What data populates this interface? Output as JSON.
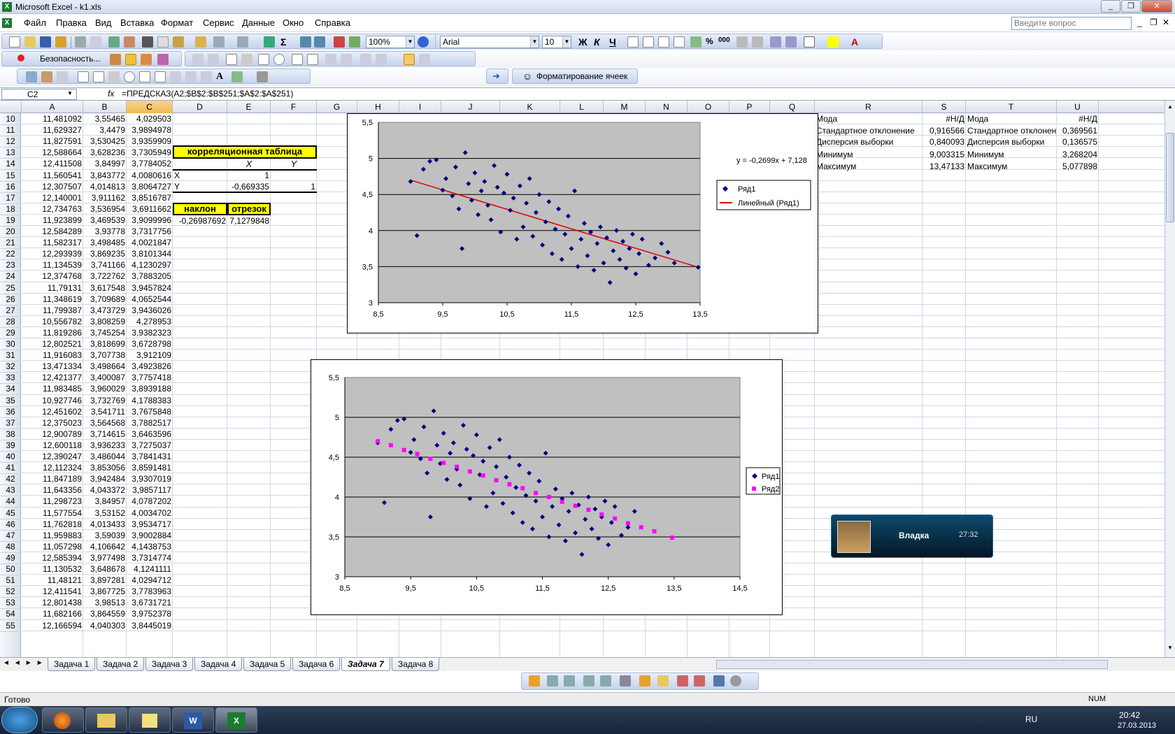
{
  "window": {
    "title": "Microsoft Excel - k1.xls"
  },
  "menu": [
    "Файл",
    "Правка",
    "Вид",
    "Вставка",
    "Формат",
    "Сервис",
    "Данные",
    "Окно",
    "Справка"
  ],
  "help_search": {
    "placeholder": "Введите вопрос"
  },
  "toolbar": {
    "zoom": "100%",
    "font": "Arial",
    "font_size": "10",
    "security_label": "Безопасность...",
    "format_cells_label": "Форматирование ячеек"
  },
  "formula_bar": {
    "name_box": "C2",
    "fx": "fx",
    "formula": "=ПРЕДСКАЗ(A2;$B$2:$B$251;$A$2:$A$251)"
  },
  "columns": [
    "A",
    "B",
    "C",
    "D",
    "E",
    "F",
    "G",
    "H",
    "I",
    "J",
    "K",
    "L",
    "M",
    "N",
    "O",
    "P",
    "Q",
    "R",
    "S",
    "T",
    "U"
  ],
  "rows": [
    {
      "n": "10",
      "a": "11,481092",
      "b": "3,55465",
      "c": "4,029503"
    },
    {
      "n": "11",
      "a": "11,629327",
      "b": "3,4479",
      "c": "3,9894978"
    },
    {
      "n": "12",
      "a": "11,827591",
      "b": "3,530425",
      "c": "3,9359909"
    },
    {
      "n": "13",
      "a": "12,588664",
      "b": "3,628236",
      "c": "3,7305949"
    },
    {
      "n": "14",
      "a": "12,411508",
      "b": "3,84997",
      "c": "3,7784052"
    },
    {
      "n": "15",
      "a": "11,560541",
      "b": "3,843772",
      "c": "4,0080616"
    },
    {
      "n": "16",
      "a": "12,307507",
      "b": "4,014813",
      "c": "3,8064727"
    },
    {
      "n": "17",
      "a": "12,140001",
      "b": "3,911162",
      "c": "3,8516787"
    },
    {
      "n": "18",
      "a": "12,734763",
      "b": "3,536954",
      "c": "3,6911662"
    },
    {
      "n": "19",
      "a": "11,923899",
      "b": "3,469539",
      "c": "3,9099996"
    },
    {
      "n": "20",
      "a": "12,584289",
      "b": "3,93778",
      "c": "3,7317756"
    },
    {
      "n": "21",
      "a": "11,582317",
      "b": "3,498485",
      "c": "4,0021847"
    },
    {
      "n": "22",
      "a": "12,293939",
      "b": "3,869235",
      "c": "3,8101344"
    },
    {
      "n": "23",
      "a": "11,134539",
      "b": "3,741166",
      "c": "4,1230297"
    },
    {
      "n": "24",
      "a": "12,374768",
      "b": "3,722762",
      "c": "3,7883205"
    },
    {
      "n": "25",
      "a": "11,79131",
      "b": "3,617548",
      "c": "3,9457824"
    },
    {
      "n": "26",
      "a": "11,348619",
      "b": "3,709689",
      "c": "4,0652544"
    },
    {
      "n": "27",
      "a": "11,799387",
      "b": "3,473729",
      "c": "3,9436026"
    },
    {
      "n": "28",
      "a": "10,556782",
      "b": "3,808259",
      "c": "4,278953"
    },
    {
      "n": "29",
      "a": "11,819286",
      "b": "3,745254",
      "c": "3,9382323"
    },
    {
      "n": "30",
      "a": "12,802521",
      "b": "3,818699",
      "c": "3,6728798"
    },
    {
      "n": "31",
      "a": "11,916083",
      "b": "3,707738",
      "c": "3,912109"
    },
    {
      "n": "32",
      "a": "13,471334",
      "b": "3,498664",
      "c": "3,4923826"
    },
    {
      "n": "33",
      "a": "12,421377",
      "b": "3,400087",
      "c": "3,7757418"
    },
    {
      "n": "34",
      "a": "11,983485",
      "b": "3,960029",
      "c": "3,8939188"
    },
    {
      "n": "35",
      "a": "10,927746",
      "b": "3,732769",
      "c": "4,1788383"
    },
    {
      "n": "36",
      "a": "12,451602",
      "b": "3,541711",
      "c": "3,7675848"
    },
    {
      "n": "37",
      "a": "12,375023",
      "b": "3,564568",
      "c": "3,7882517"
    },
    {
      "n": "38",
      "a": "12,900789",
      "b": "3,714615",
      "c": "3,6463596"
    },
    {
      "n": "39",
      "a": "12,600118",
      "b": "3,936233",
      "c": "3,7275037"
    },
    {
      "n": "40",
      "a": "12,390247",
      "b": "3,486044",
      "c": "3,7841431"
    },
    {
      "n": "41",
      "a": "12,112324",
      "b": "3,853056",
      "c": "3,8591481"
    },
    {
      "n": "42",
      "a": "11,847189",
      "b": "3,942484",
      "c": "3,9307019"
    },
    {
      "n": "43",
      "a": "11,643356",
      "b": "4,043372",
      "c": "3,9857117"
    },
    {
      "n": "44",
      "a": "11,298723",
      "b": "3,84957",
      "c": "4,0787202"
    },
    {
      "n": "45",
      "a": "11,577554",
      "b": "3,53152",
      "c": "4,0034702"
    },
    {
      "n": "46",
      "a": "11,762818",
      "b": "4,013433",
      "c": "3,9534717"
    },
    {
      "n": "47",
      "a": "11,959883",
      "b": "3,59039",
      "c": "3,9002884"
    },
    {
      "n": "48",
      "a": "11,057298",
      "b": "4,106642",
      "c": "4,1438753"
    },
    {
      "n": "49",
      "a": "12,585394",
      "b": "3,977498",
      "c": "3,7314774"
    },
    {
      "n": "50",
      "a": "11,130532",
      "b": "3,648678",
      "c": "4,1241111"
    },
    {
      "n": "51",
      "a": "11,48121",
      "b": "3,897281",
      "c": "4,0294712"
    },
    {
      "n": "52",
      "a": "12,411541",
      "b": "3,867725",
      "c": "3,7783963"
    },
    {
      "n": "53",
      "a": "12,801438",
      "b": "3,98513",
      "c": "3,6731721"
    },
    {
      "n": "54",
      "a": "11,682166",
      "b": "3,864559",
      "c": "3,9752378"
    },
    {
      "n": "55",
      "a": "12,166594",
      "b": "4,040303",
      "c": "3,8445019"
    }
  ],
  "corr": {
    "title": "корреляционная таблица",
    "col_x": "X",
    "col_y": "Y",
    "row_x": "X",
    "row_y": "Y",
    "xx": "1",
    "yx": "-0,669335",
    "yy": "1"
  },
  "regression": {
    "slope_label": "наклон",
    "intercept_label": "отрезок",
    "slope": "-0,26987692",
    "intercept": "7,1279848"
  },
  "stats": [
    {
      "label": "Мода",
      "s": "#Н/Д",
      "label2": "Мода",
      "u": "#Н/Д"
    },
    {
      "label": "Стандартное отклонение",
      "s": "0,916566",
      "label2": "Стандартное отклонен",
      "u": "0,369561"
    },
    {
      "label": "Дисперсия выборки",
      "s": "0,840093",
      "label2": "Дисперсия выборки",
      "u": "0,136575"
    },
    {
      "label": "Минимум",
      "s": "9,003315",
      "label2": "Минимум",
      "u": "3,268204"
    },
    {
      "label": "Максимум",
      "s": "13,47133",
      "label2": "Максимум",
      "u": "5,077898"
    }
  ],
  "chart_data": [
    {
      "type": "scatter",
      "x_ticks": [
        "8,5",
        "9,5",
        "10,5",
        "11,5",
        "12,5",
        "13,5"
      ],
      "y_ticks": [
        "3",
        "3,5",
        "4",
        "4,5",
        "5",
        "5,5"
      ],
      "xlim": [
        8.5,
        13.5
      ],
      "ylim": [
        3,
        5.5
      ],
      "grid": "horizontal",
      "trendline_equation": "y = -0,2699x + 7,128",
      "legend": [
        "Ряд1",
        "Линейный (Ряд1)"
      ],
      "legend_position": "right",
      "trendline": {
        "slope": -0.2699,
        "intercept": 7.128,
        "x_from": 9.0,
        "x_to": 13.47
      },
      "series": [
        {
          "name": "Ряд1",
          "color": "#000080",
          "points": [
            [
              9.0,
              4.68
            ],
            [
              9.1,
              3.93
            ],
            [
              9.2,
              4.85
            ],
            [
              9.3,
              4.96
            ],
            [
              9.4,
              4.98
            ],
            [
              9.5,
              4.56
            ],
            [
              9.55,
              4.72
            ],
            [
              9.65,
              4.48
            ],
            [
              9.7,
              4.88
            ],
            [
              9.75,
              4.3
            ],
            [
              9.8,
              3.75
            ],
            [
              9.85,
              5.08
            ],
            [
              9.9,
              4.65
            ],
            [
              9.95,
              4.42
            ],
            [
              10.0,
              4.8
            ],
            [
              10.05,
              4.22
            ],
            [
              10.1,
              4.55
            ],
            [
              10.15,
              4.68
            ],
            [
              10.2,
              4.35
            ],
            [
              10.25,
              4.15
            ],
            [
              10.3,
              4.9
            ],
            [
              10.35,
              4.6
            ],
            [
              10.4,
              3.98
            ],
            [
              10.45,
              4.52
            ],
            [
              10.5,
              4.78
            ],
            [
              10.55,
              4.28
            ],
            [
              10.6,
              4.45
            ],
            [
              10.65,
              3.88
            ],
            [
              10.7,
              4.62
            ],
            [
              10.75,
              4.05
            ],
            [
              10.8,
              4.38
            ],
            [
              10.85,
              4.72
            ],
            [
              10.9,
              3.92
            ],
            [
              10.95,
              4.25
            ],
            [
              11.0,
              4.5
            ],
            [
              11.05,
              3.8
            ],
            [
              11.1,
              4.12
            ],
            [
              11.15,
              4.4
            ],
            [
              11.2,
              3.68
            ],
            [
              11.25,
              4.02
            ],
            [
              11.3,
              4.3
            ],
            [
              11.35,
              3.6
            ],
            [
              11.4,
              3.95
            ],
            [
              11.45,
              4.2
            ],
            [
              11.5,
              3.75
            ],
            [
              11.55,
              4.55
            ],
            [
              11.6,
              3.5
            ],
            [
              11.65,
              3.88
            ],
            [
              11.7,
              4.1
            ],
            [
              11.75,
              3.65
            ],
            [
              11.8,
              3.98
            ],
            [
              11.85,
              3.45
            ],
            [
              11.9,
              3.82
            ],
            [
              11.95,
              4.05
            ],
            [
              12.0,
              3.55
            ],
            [
              12.05,
              3.9
            ],
            [
              12.1,
              3.28
            ],
            [
              12.15,
              3.72
            ],
            [
              12.2,
              4.0
            ],
            [
              12.25,
              3.6
            ],
            [
              12.3,
              3.85
            ],
            [
              12.35,
              3.48
            ],
            [
              12.4,
              3.75
            ],
            [
              12.45,
              3.95
            ],
            [
              12.5,
              3.4
            ],
            [
              12.55,
              3.68
            ],
            [
              12.6,
              3.88
            ],
            [
              12.7,
              3.52
            ],
            [
              12.8,
              3.62
            ],
            [
              12.9,
              3.82
            ],
            [
              13.0,
              3.7
            ],
            [
              13.1,
              3.55
            ],
            [
              13.47,
              3.49
            ]
          ]
        }
      ]
    },
    {
      "type": "scatter",
      "x_ticks": [
        "8,5",
        "9,5",
        "10,5",
        "11,5",
        "12,5",
        "13,5",
        "14,5"
      ],
      "y_ticks": [
        "3",
        "3,5",
        "4",
        "4,5",
        "5",
        "5,5"
      ],
      "xlim": [
        8.5,
        14.5
      ],
      "ylim": [
        3,
        5.5
      ],
      "grid": "horizontal",
      "legend": [
        "Ряд1",
        "Ряд2"
      ],
      "legend_position": "right",
      "series": [
        {
          "name": "Ряд1",
          "color": "#000080",
          "points": [
            [
              9.0,
              4.68
            ],
            [
              9.1,
              3.93
            ],
            [
              9.2,
              4.85
            ],
            [
              9.3,
              4.96
            ],
            [
              9.4,
              4.98
            ],
            [
              9.5,
              4.56
            ],
            [
              9.55,
              4.72
            ],
            [
              9.65,
              4.48
            ],
            [
              9.7,
              4.88
            ],
            [
              9.75,
              4.3
            ],
            [
              9.8,
              3.75
            ],
            [
              9.85,
              5.08
            ],
            [
              9.9,
              4.65
            ],
            [
              9.95,
              4.42
            ],
            [
              10.0,
              4.8
            ],
            [
              10.05,
              4.22
            ],
            [
              10.1,
              4.55
            ],
            [
              10.15,
              4.68
            ],
            [
              10.2,
              4.35
            ],
            [
              10.25,
              4.15
            ],
            [
              10.3,
              4.9
            ],
            [
              10.35,
              4.6
            ],
            [
              10.4,
              3.98
            ],
            [
              10.45,
              4.52
            ],
            [
              10.5,
              4.78
            ],
            [
              10.55,
              4.28
            ],
            [
              10.6,
              4.45
            ],
            [
              10.65,
              3.88
            ],
            [
              10.7,
              4.62
            ],
            [
              10.75,
              4.05
            ],
            [
              10.8,
              4.38
            ],
            [
              10.85,
              4.72
            ],
            [
              10.9,
              3.92
            ],
            [
              10.95,
              4.25
            ],
            [
              11.0,
              4.5
            ],
            [
              11.05,
              3.8
            ],
            [
              11.1,
              4.12
            ],
            [
              11.15,
              4.4
            ],
            [
              11.2,
              3.68
            ],
            [
              11.25,
              4.02
            ],
            [
              11.3,
              4.3
            ],
            [
              11.35,
              3.6
            ],
            [
              11.4,
              3.95
            ],
            [
              11.45,
              4.2
            ],
            [
              11.5,
              3.75
            ],
            [
              11.55,
              4.55
            ],
            [
              11.6,
              3.5
            ],
            [
              11.65,
              3.88
            ],
            [
              11.7,
              4.1
            ],
            [
              11.75,
              3.65
            ],
            [
              11.8,
              3.98
            ],
            [
              11.85,
              3.45
            ],
            [
              11.9,
              3.82
            ],
            [
              11.95,
              4.05
            ],
            [
              12.0,
              3.55
            ],
            [
              12.05,
              3.9
            ],
            [
              12.1,
              3.28
            ],
            [
              12.15,
              3.72
            ],
            [
              12.2,
              4.0
            ],
            [
              12.25,
              3.6
            ],
            [
              12.3,
              3.85
            ],
            [
              12.35,
              3.48
            ],
            [
              12.4,
              3.75
            ],
            [
              12.45,
              3.95
            ],
            [
              12.5,
              3.4
            ],
            [
              12.55,
              3.68
            ],
            [
              12.6,
              3.88
            ],
            [
              12.7,
              3.52
            ],
            [
              12.8,
              3.62
            ],
            [
              12.9,
              3.82
            ]
          ]
        },
        {
          "name": "Ряд2",
          "color": "#ff00ff",
          "points": [
            [
              9.0,
              4.7
            ],
            [
              9.2,
              4.65
            ],
            [
              9.4,
              4.59
            ],
            [
              9.6,
              4.54
            ],
            [
              9.8,
              4.48
            ],
            [
              10.0,
              4.43
            ],
            [
              10.2,
              4.38
            ],
            [
              10.4,
              4.32
            ],
            [
              10.6,
              4.27
            ],
            [
              10.8,
              4.21
            ],
            [
              11.0,
              4.16
            ],
            [
              11.2,
              4.11
            ],
            [
              11.4,
              4.05
            ],
            [
              11.6,
              4.0
            ],
            [
              11.8,
              3.94
            ],
            [
              12.0,
              3.89
            ],
            [
              12.2,
              3.84
            ],
            [
              12.4,
              3.78
            ],
            [
              12.6,
              3.73
            ],
            [
              12.8,
              3.67
            ],
            [
              13.0,
              3.62
            ],
            [
              13.2,
              3.57
            ],
            [
              13.47,
              3.49
            ]
          ]
        }
      ]
    }
  ],
  "sheet_tabs": [
    "Задача 1",
    "Задача 2",
    "Задача 3",
    "Задача 4",
    "Задача 5",
    "Задача 6",
    "Задача 7",
    "Задача 8"
  ],
  "active_tab": "Задача 7",
  "status": {
    "text": "Готово",
    "num": "NUM"
  },
  "media_widget": {
    "name": "Владка",
    "time": "27:32"
  },
  "taskbar": {
    "lang": "RU",
    "time": "20:42",
    "date": "27.03.2013"
  }
}
